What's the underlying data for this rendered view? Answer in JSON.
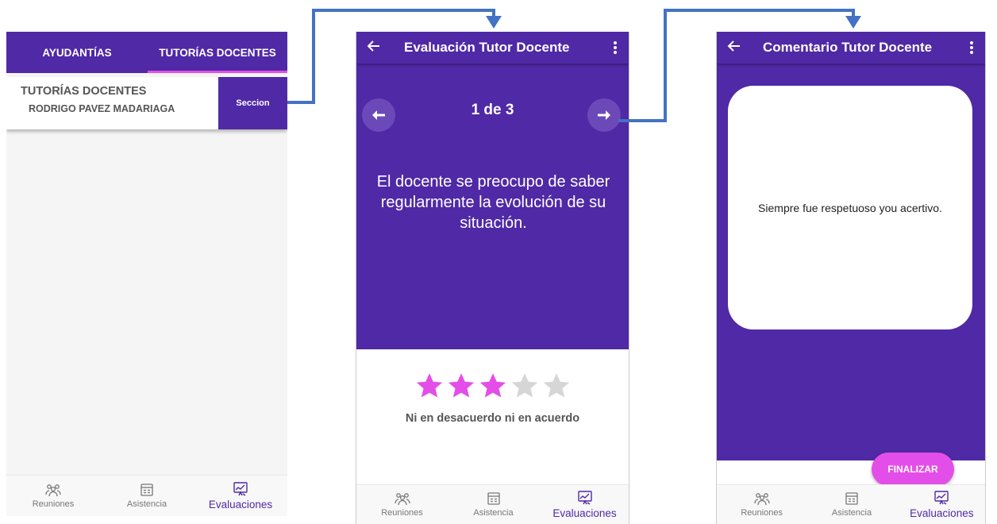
{
  "colors": {
    "primary": "#5029a6",
    "accent": "#e44ee8",
    "connector": "#4472c4",
    "star_empty": "#d6d6d6"
  },
  "screen1": {
    "tabs": [
      {
        "label": "AYUDANTÍAS"
      },
      {
        "label": "TUTORÍAS DOCENTES"
      }
    ],
    "active_tab_index": 1,
    "card": {
      "title": "TUTORÍAS DOCENTES",
      "subtitle": "RODRIGO PAVEZ MADARIAGA",
      "button_label": "Seccion"
    }
  },
  "bottom_nav": [
    {
      "label": "Reuniones",
      "icon": "people-group-icon"
    },
    {
      "label": "Asistencia",
      "icon": "calendar-icon"
    },
    {
      "label": "Evaluaciones",
      "icon": "evaluation-icon",
      "active": true
    }
  ],
  "screen2": {
    "title": "Evaluación Tutor Docente",
    "counter": "1 de 3",
    "question": "El docente se preocupo de saber regularmente la evolución de su situación.",
    "rating": 3,
    "rating_max": 5,
    "rating_label": "Ni en desacuerdo ni en acuerdo"
  },
  "screen3": {
    "title": "Comentario Tutor Docente",
    "comment": "Siempre fue respetuoso you acertivo.",
    "finish_button": "FINALIZAR"
  }
}
